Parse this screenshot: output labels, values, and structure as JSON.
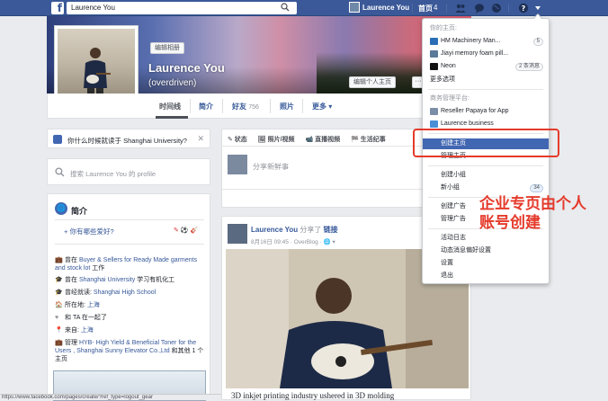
{
  "topbar": {
    "search_value": "Laurence You",
    "user_name": "Laurence You",
    "home_label": "首页",
    "home_count": "4"
  },
  "profile": {
    "edit_photo_label": "编辑相册",
    "name": "Laurence You",
    "nickname": "(overdriven)",
    "edit_profile_label": "编辑个人主页",
    "more_dots": "···"
  },
  "tabs": [
    {
      "label": "时间线"
    },
    {
      "label": "简介"
    },
    {
      "label": "好友",
      "count": "756"
    },
    {
      "label": "照片"
    },
    {
      "label": "更多 ▾"
    }
  ],
  "school_prompt": "你什么时候就读于 Shanghai University?",
  "profile_search_placeholder": "搜索 Laurence You 的 profile",
  "intro": {
    "title": "简介",
    "hobby_prompt": "+ 你有哪些爱好?",
    "items": [
      {
        "icon": "💼",
        "prefix": "曾在 ",
        "link": "Buyer & Sellers for Ready Made garments and stock lot",
        "suffix": " 工作"
      },
      {
        "icon": "🎓",
        "prefix": "曾在 ",
        "link": "Shanghai University",
        "suffix": " 学习有机化工"
      },
      {
        "icon": "🎓",
        "prefix": "曾经就读: ",
        "link": "Shanghai High School",
        "suffix": ""
      },
      {
        "icon": "🏠",
        "prefix": "所在地: ",
        "link": "上海",
        "suffix": ""
      },
      {
        "icon": "♥",
        "prefix": "和 TA 在一起了",
        "link": "",
        "suffix": ""
      },
      {
        "icon": "📍",
        "prefix": "来自: ",
        "link": "上海",
        "suffix": ""
      },
      {
        "icon": "💼",
        "prefix": "管理 ",
        "link": "HYB- High Yield & Beneficial Toner for the Users , Shanghai Sunny Elevator Co.,Ltd",
        "suffix": " 和其他 1 个主页"
      }
    ]
  },
  "composer": {
    "tabs": [
      "✎ 状态",
      "🖼 照片/视频",
      "📹 直播视频",
      "🏁 生活纪事"
    ],
    "placeholder": "分享新鲜事",
    "button": "🔒 公"
  },
  "post": {
    "author": "Laurence You",
    "verb": " 分享了",
    "link_word": "链接",
    "meta": "8月16日 09:45 · OverBlog · 🌐 ▾",
    "caption": "3D inkjet printing industry ushered in 3D molding"
  },
  "menu": {
    "pages_head": "你的主页:",
    "pages": [
      {
        "label": "HM Machinery Man...",
        "badge": "5",
        "color": "#2a6fb5"
      },
      {
        "label": "Jiayi memory foam pill...",
        "badge": "",
        "color": "#5b7a9a"
      },
      {
        "label": "Neon",
        "badge": "2 条消息",
        "color": "#111111"
      }
    ],
    "more_options": "更多选项",
    "biz_head": "商务管理平台:",
    "biz": [
      {
        "label": "Reseller Papaya for App",
        "color": "#7b8ea8"
      },
      {
        "label": "Laurence business",
        "color": "#4a8fd6"
      }
    ],
    "create_page": "创建主页",
    "manage_pages": "管理主页",
    "create_group": "创建小组",
    "new_groups": "新小组",
    "new_groups_badge": "34",
    "create_ad": "创建广告",
    "manage_ads": "管理广告",
    "activity_log": "活动日志",
    "news_prefs": "动态消息偏好设置",
    "settings": "设置",
    "logout": "退出"
  },
  "annotation": "企业专页由个人\n账号创建",
  "status_url": "https://www.facebook.com/pages/create/?ref_type=logout_gear"
}
